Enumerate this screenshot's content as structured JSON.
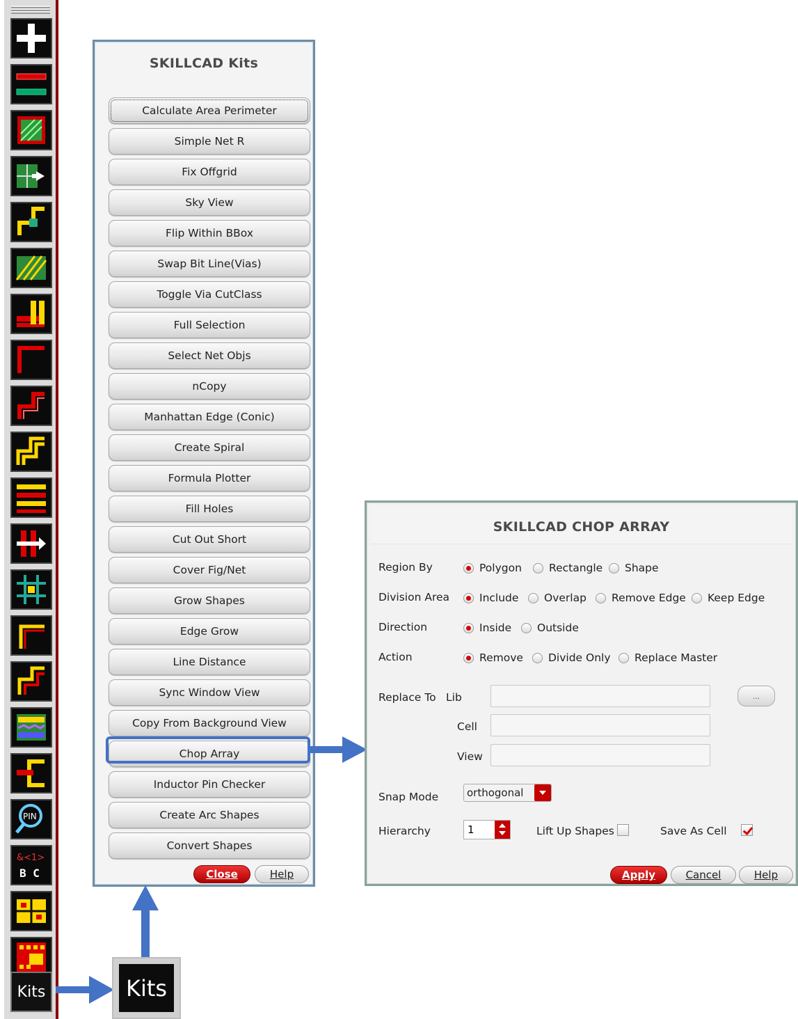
{
  "toolbar": {
    "icons": [
      "add-icon",
      "layer-lines-icon",
      "fill-pattern-icon",
      "move-grid-icon",
      "step-wire-icon",
      "hatched-block-icon",
      "stacked-bars-icon",
      "corner-wire-icon",
      "stair-wire-icon",
      "double-stair-icon",
      "bus-lines-icon",
      "split-arrow-icon",
      "cross-net-icon",
      "corner-path-icon",
      "bent-path-icon",
      "pattern-fill-icon",
      "bracket-shape-icon",
      "pin-search-icon",
      "label-bc-icon",
      "block-grid-icon",
      "via-array-icon"
    ],
    "kits_label": "Kits",
    "label_text": "&<1>\nB C"
  },
  "kits_window": {
    "title": "SKILLCAD Kits",
    "buttons": [
      "Calculate Area Perimeter",
      "Simple Net R",
      "Fix Offgrid",
      "Sky View",
      "Flip Within BBox",
      "Swap Bit Line(Vias)",
      "Toggle Via CutClass",
      "Full Selection",
      "Select Net Objs",
      "nCopy",
      "Manhattan Edge (Conic)",
      "Create Spiral",
      "Formula Plotter",
      "Fill Holes",
      "Cut Out Short",
      "Cover Fig/Net",
      "Grow Shapes",
      "Edge Grow",
      "Line Distance",
      "Sync Window View",
      "Copy From Background View",
      "Chop Array",
      "Inductor Pin Checker",
      "Create Arc Shapes",
      "Convert Shapes"
    ],
    "highlighted": "Chop Array",
    "close_label": "Close",
    "help_label": "Help"
  },
  "kits_zoom": {
    "label": "Kits"
  },
  "chop_dialog": {
    "title": "SKILLCAD CHOP ARRAY",
    "region_by": {
      "label": "Region By",
      "options": [
        "Polygon",
        "Rectangle",
        "Shape"
      ],
      "selected": "Polygon"
    },
    "division_area": {
      "label": "Division Area",
      "options": [
        "Include",
        "Overlap",
        "Remove Edge",
        "Keep Edge"
      ],
      "selected": "Include"
    },
    "direction": {
      "label": "Direction",
      "options": [
        "Inside",
        "Outside"
      ],
      "selected": "Inside"
    },
    "action": {
      "label": "Action",
      "options": [
        "Remove",
        "Divide Only",
        "Replace Master"
      ],
      "selected": "Remove"
    },
    "replace_to": {
      "label": "Replace To",
      "lib_label": "Lib",
      "lib_value": "",
      "cell_label": "Cell",
      "cell_value": "",
      "view_label": "View",
      "view_value": "",
      "browse_label": "..."
    },
    "snap_mode": {
      "label": "Snap Mode",
      "value": "orthogonal"
    },
    "hierarchy": {
      "label": "Hierarchy",
      "value": "1"
    },
    "lift_up_shapes": {
      "label": "Lift Up Shapes",
      "checked": false
    },
    "save_as_cell": {
      "label": "Save As Cell",
      "checked": true
    },
    "apply_label": "Apply",
    "cancel_label": "Cancel",
    "help_label": "Help"
  },
  "colors": {
    "accent_blue": "#4472c4",
    "brand_red": "#c40000"
  }
}
